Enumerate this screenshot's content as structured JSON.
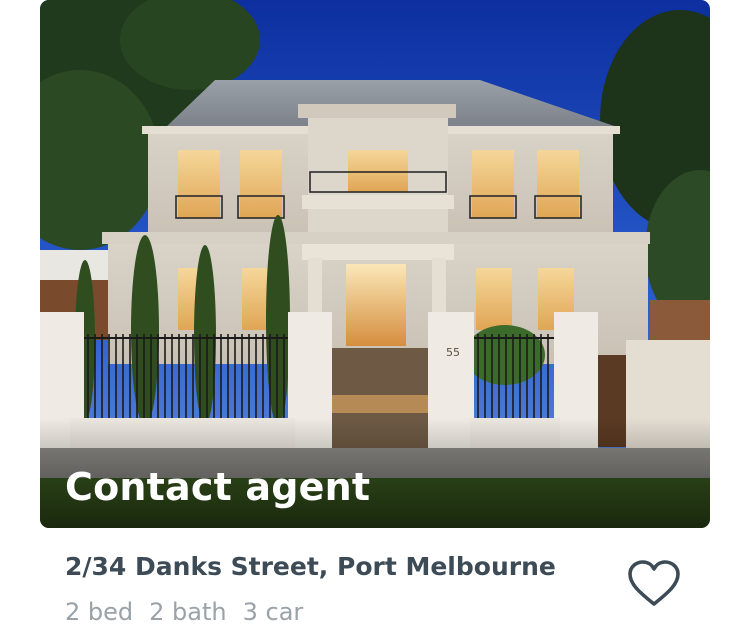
{
  "listing": {
    "price_label": "Contact agent",
    "address": "2/34 Danks Street, Port Melbourne",
    "features": [
      "2 bed",
      "2 bath",
      "3 car"
    ],
    "house_number": "55",
    "favorite_icon": "heart-outline-icon"
  },
  "colors": {
    "address_text": "#3d4b56",
    "features_text": "#9aa2a8",
    "icon": "#3d4b56"
  }
}
